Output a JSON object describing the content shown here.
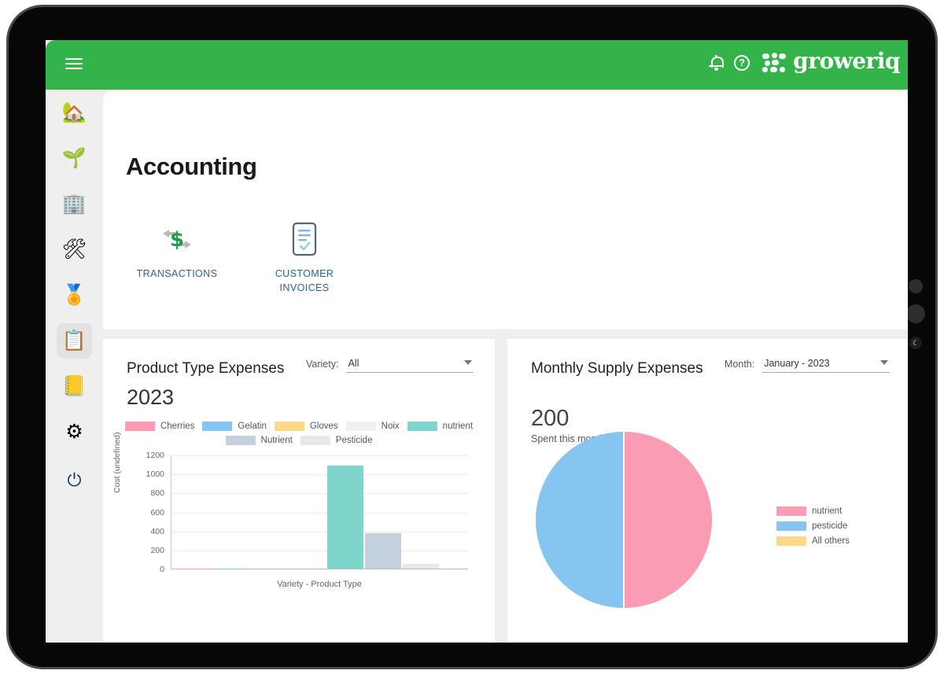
{
  "app": {
    "brand": "groweriq",
    "header_color": "#34b34a",
    "accent_link_color": "#2a6496"
  },
  "topbar": {
    "menu_icon": "hamburger-icon",
    "notifications_icon": "bell-icon",
    "help_icon": "question-mark-icon"
  },
  "sidebar": {
    "items": [
      {
        "name": "home",
        "glyph": "🏡",
        "active": false
      },
      {
        "name": "cultivation",
        "glyph": "🌱",
        "active": false
      },
      {
        "name": "staff",
        "glyph": "🏢",
        "active": false
      },
      {
        "name": "inventory",
        "glyph": "🛠",
        "active": false
      },
      {
        "name": "quality",
        "glyph": "🏅",
        "active": false
      },
      {
        "name": "accounting",
        "glyph": "📋",
        "active": true
      },
      {
        "name": "reports",
        "glyph": "📒",
        "active": false
      },
      {
        "name": "settings",
        "glyph": "⚙",
        "active": false
      },
      {
        "name": "logout",
        "glyph": "⏻",
        "active": false
      }
    ]
  },
  "page": {
    "title": "Accounting",
    "shortcuts": [
      {
        "label": "TRANSACTIONS",
        "icon": "money-transfer-icon"
      },
      {
        "label": "CUSTOMER INVOICES",
        "icon": "document-check-icon"
      }
    ]
  },
  "bar_card": {
    "title": "Product Type Expenses",
    "year": "2023",
    "filter_label": "Variety:",
    "filter_value": "All"
  },
  "pie_card": {
    "title": "Monthly Supply Expenses",
    "filter_label": "Month:",
    "filter_value": "January - 2023",
    "amount": "200",
    "amount_caption": "Spent this month"
  },
  "chart_data": [
    {
      "type": "bar",
      "title": "Product Type Expenses 2023",
      "xlabel": "Variety - Product Type",
      "ylabel": "Cost (undefined)",
      "ylim": [
        0,
        1200
      ],
      "yticks": [
        0,
        200,
        400,
        600,
        800,
        1000,
        1200
      ],
      "grid": true,
      "legend_position": "top",
      "categories": [
        "Cherries",
        "Gelatin",
        "Gloves",
        "Noix",
        "nutrient",
        "Nutrient",
        "Pesticide"
      ],
      "values": [
        4,
        2,
        0,
        0,
        1085,
        370,
        48
      ],
      "colors": [
        "#f99cb4",
        "#85c5f0",
        "#fcd98a",
        "#f0f0f0",
        "#7fd4cc",
        "#c2d1dd",
        "#e8e8e8"
      ]
    },
    {
      "type": "pie",
      "title": "Monthly Supply Expenses",
      "total": 200,
      "labels": [
        "nutrient",
        "pesticide",
        "All others"
      ],
      "values": [
        50,
        50,
        0
      ],
      "colors": [
        "#f99cb4",
        "#85c5f0",
        "#fcd98a"
      ],
      "legend_position": "right"
    }
  ]
}
